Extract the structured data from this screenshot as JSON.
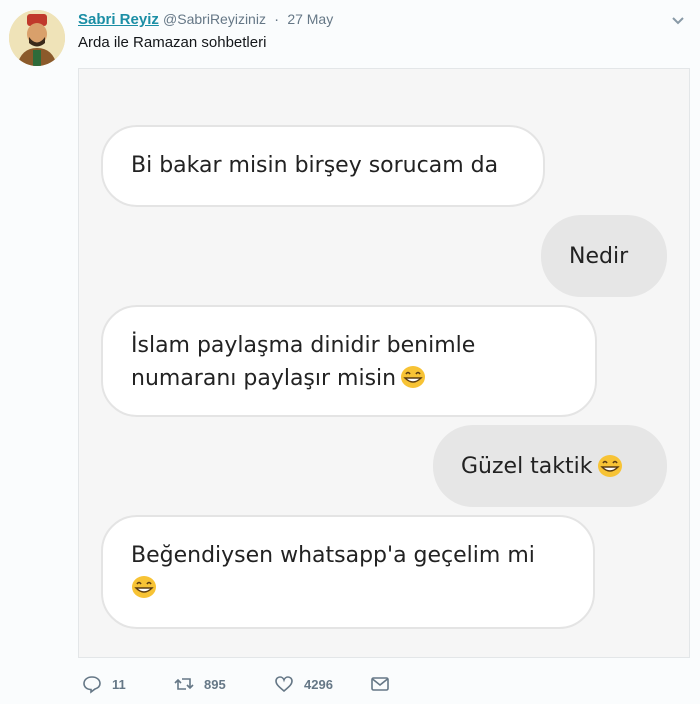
{
  "tweet": {
    "author_name": "Sabri Reyiz",
    "handle": "@SabriReyiziniz",
    "separator": "·",
    "date": "27 May",
    "text": "Arda ile Ramazan sohbetleri"
  },
  "chat": {
    "messages": [
      {
        "side": "left",
        "text": "Bi bakar misin birşey sorucam da"
      },
      {
        "side": "right",
        "text": "Nedir"
      },
      {
        "side": "left",
        "text_line1": "İslam paylaşma dinidir benimle",
        "text_line2": "numaranı paylaşır misin",
        "emoji": "laughing-face"
      },
      {
        "side": "right",
        "text": "Güzel taktik",
        "emoji": "laughing-face"
      },
      {
        "side": "left",
        "text": "Beğendiysen whatsapp'a geçelim mi",
        "emoji": "laughing-face"
      }
    ]
  },
  "actions": {
    "replies": "11",
    "retweets": "895",
    "likes": "4296"
  },
  "colors": {
    "name_link": "#1b8ea5",
    "meta_gray": "#657786",
    "emoji_yellow": "#f7c335"
  }
}
